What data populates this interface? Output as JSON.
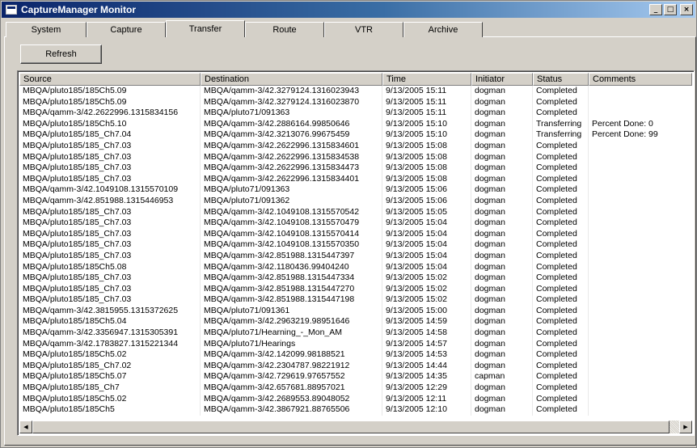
{
  "window": {
    "title": "CaptureManager Monitor",
    "minimize": "_",
    "maximize": "□",
    "close": "×"
  },
  "tabs": [
    {
      "label": "System"
    },
    {
      "label": "Capture"
    },
    {
      "label": "Transfer"
    },
    {
      "label": "Route"
    },
    {
      "label": "VTR"
    },
    {
      "label": "Archive"
    }
  ],
  "active_tab": "Transfer",
  "toolbar": {
    "refresh_label": "Refresh"
  },
  "table": {
    "columns": [
      "Source",
      "Destination",
      "Time",
      "Initiator",
      "Status",
      "Comments"
    ],
    "rows": [
      [
        "MBQA/pluto185/185Ch5.09",
        "MBQA/qamm-3/42.3279124.1316023943",
        "9/13/2005 15:11",
        "dogman",
        "Completed",
        ""
      ],
      [
        "MBQA/pluto185/185Ch5.09",
        "MBQA/qamm-3/42.3279124.1316023870",
        "9/13/2005 15:11",
        "dogman",
        "Completed",
        ""
      ],
      [
        "MBQA/qamm-3/42.2622996.1315834156",
        "MBQA/pluto71/091363",
        "9/13/2005 15:11",
        "dogman",
        "Completed",
        ""
      ],
      [
        "MBQA/pluto185/185Ch5.10",
        "MBQA/qamm-3/42.2886164.99850646",
        "9/13/2005 15:10",
        "dogman",
        "Transferring",
        "Percent Done: 0"
      ],
      [
        "MBQA/pluto185/185_Ch7.04",
        "MBQA/qamm-3/42.3213076.99675459",
        "9/13/2005 15:10",
        "dogman",
        "Transferring",
        "Percent Done: 99"
      ],
      [
        "MBQA/pluto185/185_Ch7.03",
        "MBQA/qamm-3/42.2622996.1315834601",
        "9/13/2005 15:08",
        "dogman",
        "Completed",
        ""
      ],
      [
        "MBQA/pluto185/185_Ch7.03",
        "MBQA/qamm-3/42.2622996.1315834538",
        "9/13/2005 15:08",
        "dogman",
        "Completed",
        ""
      ],
      [
        "MBQA/pluto185/185_Ch7.03",
        "MBQA/qamm-3/42.2622996.1315834473",
        "9/13/2005 15:08",
        "dogman",
        "Completed",
        ""
      ],
      [
        "MBQA/pluto185/185_Ch7.03",
        "MBQA/qamm-3/42.2622996.1315834401",
        "9/13/2005 15:08",
        "dogman",
        "Completed",
        ""
      ],
      [
        "MBQA/qamm-3/42.1049108.1315570109",
        "MBQA/pluto71/091363",
        "9/13/2005 15:06",
        "dogman",
        "Completed",
        ""
      ],
      [
        "MBQA/qamm-3/42.851988.1315446953",
        "MBQA/pluto71/091362",
        "9/13/2005 15:06",
        "dogman",
        "Completed",
        ""
      ],
      [
        "MBQA/pluto185/185_Ch7.03",
        "MBQA/qamm-3/42.1049108.1315570542",
        "9/13/2005 15:05",
        "dogman",
        "Completed",
        ""
      ],
      [
        "MBQA/pluto185/185_Ch7.03",
        "MBQA/qamm-3/42.1049108.1315570479",
        "9/13/2005 15:04",
        "dogman",
        "Completed",
        ""
      ],
      [
        "MBQA/pluto185/185_Ch7.03",
        "MBQA/qamm-3/42.1049108.1315570414",
        "9/13/2005 15:04",
        "dogman",
        "Completed",
        ""
      ],
      [
        "MBQA/pluto185/185_Ch7.03",
        "MBQA/qamm-3/42.1049108.1315570350",
        "9/13/2005 15:04",
        "dogman",
        "Completed",
        ""
      ],
      [
        "MBQA/pluto185/185_Ch7.03",
        "MBQA/qamm-3/42.851988.1315447397",
        "9/13/2005 15:04",
        "dogman",
        "Completed",
        ""
      ],
      [
        "MBQA/pluto185/185Ch5.08",
        "MBQA/qamm-3/42.1180436.99404240",
        "9/13/2005 15:04",
        "dogman",
        "Completed",
        ""
      ],
      [
        "MBQA/pluto185/185_Ch7.03",
        "MBQA/qamm-3/42.851988.1315447334",
        "9/13/2005 15:02",
        "dogman",
        "Completed",
        ""
      ],
      [
        "MBQA/pluto185/185_Ch7.03",
        "MBQA/qamm-3/42.851988.1315447270",
        "9/13/2005 15:02",
        "dogman",
        "Completed",
        ""
      ],
      [
        "MBQA/pluto185/185_Ch7.03",
        "MBQA/qamm-3/42.851988.1315447198",
        "9/13/2005 15:02",
        "dogman",
        "Completed",
        ""
      ],
      [
        "MBQA/qamm-3/42.3815955.1315372625",
        "MBQA/pluto71/091361",
        "9/13/2005 15:00",
        "dogman",
        "Completed",
        ""
      ],
      [
        "MBQA/pluto185/185Ch5.04",
        "MBQA/qamm-3/42.2963219.98951646",
        "9/13/2005 14:59",
        "dogman",
        "Completed",
        ""
      ],
      [
        "MBQA/qamm-3/42.3356947.1315305391",
        "MBQA/pluto71/Hearning_-_Mon_AM",
        "9/13/2005 14:58",
        "dogman",
        "Completed",
        ""
      ],
      [
        "MBQA/qamm-3/42.1783827.1315221344",
        "MBQA/pluto71/Hearings",
        "9/13/2005 14:57",
        "dogman",
        "Completed",
        ""
      ],
      [
        "MBQA/pluto185/185Ch5.02",
        "MBQA/qamm-3/42.142099.98188521",
        "9/13/2005 14:53",
        "dogman",
        "Completed",
        ""
      ],
      [
        "MBQA/pluto185/185_Ch7.02",
        "MBQA/qamm-3/42.2304787.98221912",
        "9/13/2005 14:44",
        "dogman",
        "Completed",
        ""
      ],
      [
        "MBQA/pluto185/185Ch5.07",
        "MBQA/qamm-3/42.729619.97657552",
        "9/13/2005 14:35",
        "capman",
        "Completed",
        ""
      ],
      [
        "MBQA/pluto185/185_Ch7",
        "MBQA/qamm-3/42.657681.88957021",
        "9/13/2005 12:29",
        "dogman",
        "Completed",
        ""
      ],
      [
        "MBQA/pluto185/185Ch5.02",
        "MBQA/qamm-3/42.2689553.89048052",
        "9/13/2005 12:11",
        "dogman",
        "Completed",
        ""
      ],
      [
        "MBQA/pluto185/185Ch5",
        "MBQA/qamm-3/42.3867921.88765506",
        "9/13/2005 12:10",
        "dogman",
        "Completed",
        ""
      ]
    ]
  },
  "scrollbar": {
    "left_arrow": "◀",
    "right_arrow": "▶",
    "thumb_fraction": 0.985
  },
  "icons": {
    "app": "app-window-icon",
    "left": "arrow-left-icon",
    "right": "arrow-right-icon"
  }
}
